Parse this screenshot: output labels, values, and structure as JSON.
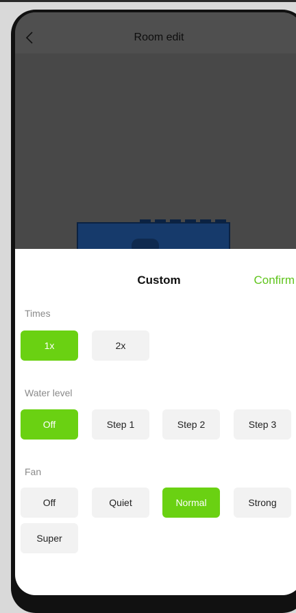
{
  "header": {
    "title": "Room edit"
  },
  "sheet": {
    "title": "Custom",
    "confirm_label": "Confirm",
    "times": {
      "label": "Times",
      "options": [
        "1x",
        "2x"
      ],
      "selected": "1x"
    },
    "water_level": {
      "label": "Water level",
      "options": [
        "Off",
        "Step 1",
        "Step 2",
        "Step 3"
      ],
      "selected": "Off"
    },
    "fan": {
      "label": "Fan",
      "options": [
        "Off",
        "Quiet",
        "Normal",
        "Strong",
        "Super"
      ],
      "selected": "Normal"
    }
  },
  "icons": {
    "back": "chevron-left-icon"
  },
  "colors": {
    "accent": "#6ad112",
    "confirm": "#5fc41b"
  }
}
